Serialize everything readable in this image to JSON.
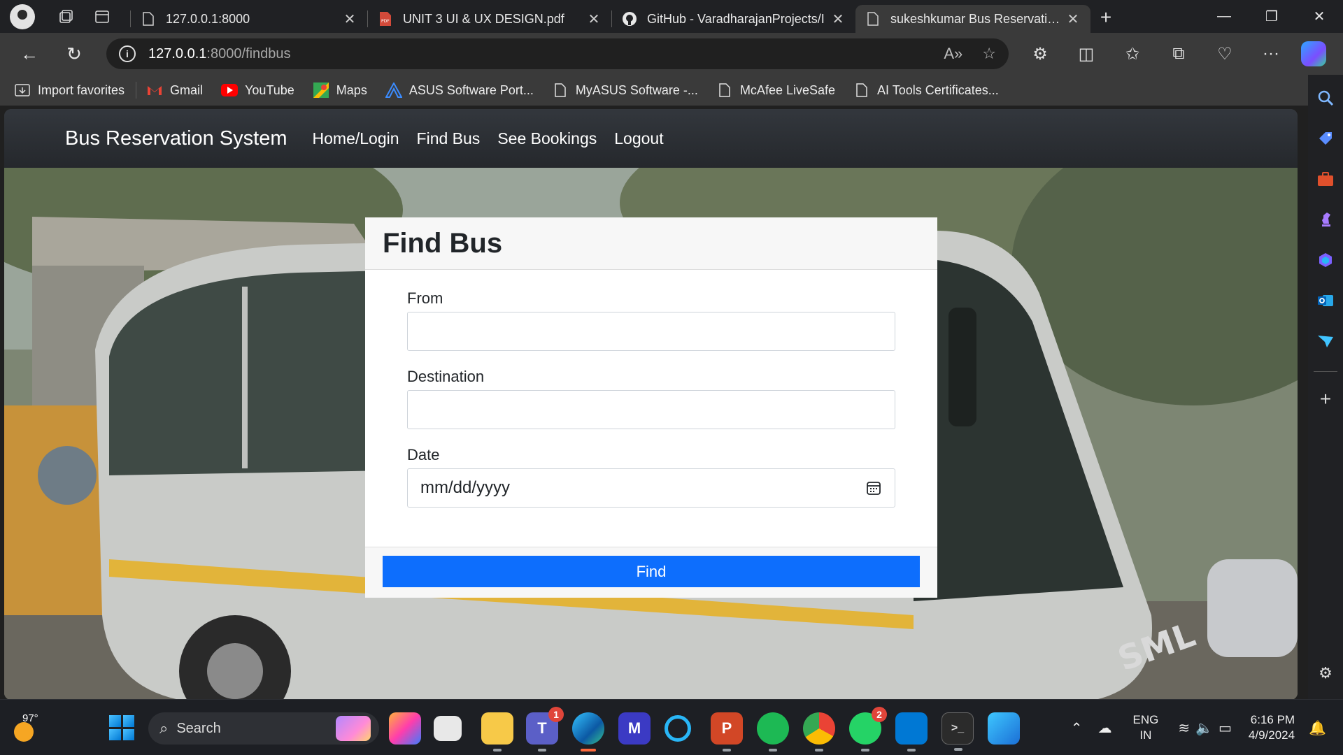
{
  "browser": {
    "tabs": [
      {
        "title": "127.0.0.1:8000",
        "icon": "page-icon",
        "active": false
      },
      {
        "title": "UNIT 3 UI & UX DESIGN.pdf",
        "icon": "pdf-icon",
        "active": false
      },
      {
        "title": "GitHub - VaradharajanProjects/I",
        "icon": "github-icon",
        "active": false
      },
      {
        "title": "sukeshkumar Bus Reservation Sy",
        "icon": "page-icon",
        "active": true
      }
    ],
    "address": {
      "host": "127.0.0.1",
      "path": ":8000/findbus"
    },
    "favorites": [
      {
        "label": "Import favorites",
        "icon": "import-icon"
      },
      {
        "label": "Gmail",
        "icon": "gmail-icon"
      },
      {
        "label": "YouTube",
        "icon": "youtube-icon"
      },
      {
        "label": "Maps",
        "icon": "maps-icon"
      },
      {
        "label": "ASUS Software Port...",
        "icon": "asus-icon"
      },
      {
        "label": "MyASUS Software -...",
        "icon": "page-icon"
      },
      {
        "label": "McAfee LiveSafe",
        "icon": "page-icon"
      },
      {
        "label": "AI Tools Certificates...",
        "icon": "page-icon"
      }
    ]
  },
  "site": {
    "brand": "Bus Reservation System",
    "nav": [
      "Home/Login",
      "Find Bus",
      "See Bookings",
      "Logout"
    ]
  },
  "form": {
    "title": "Find Bus",
    "from_label": "From",
    "from_value": "",
    "destination_label": "Destination",
    "destination_value": "",
    "date_label": "Date",
    "date_placeholder": "mm/dd/yyyy",
    "submit_label": "Find"
  },
  "taskbar": {
    "weather_temp": "97°",
    "search_placeholder": "Search",
    "teams_badge": "1",
    "whatsapp_badge": "2",
    "language": "ENG",
    "region": "IN",
    "time": "6:16 PM",
    "date": "4/9/2024"
  },
  "colors": {
    "primary_button": "#0d6efd",
    "navbar_bg": "#2b2e33",
    "card_header_bg": "#f7f7f7"
  }
}
